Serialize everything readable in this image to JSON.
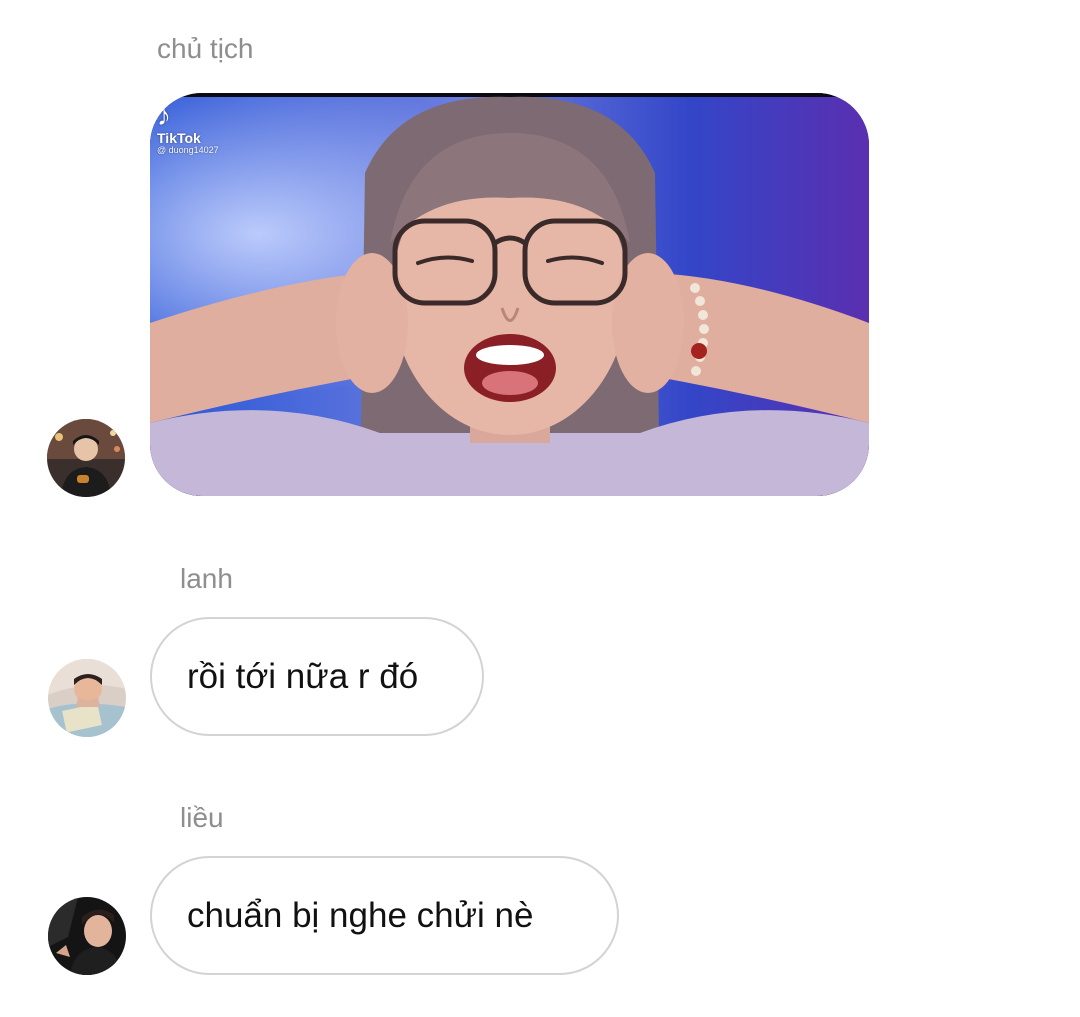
{
  "messages": [
    {
      "sender": "chủ tịch",
      "type": "media",
      "media": {
        "source": "TikTok",
        "logo_glyph": "♪",
        "handle": "@ duong14027",
        "icon": "tiktok-logo-icon"
      }
    },
    {
      "sender": "lanh",
      "type": "text",
      "text": "rồi tới nữa r đó"
    },
    {
      "sender": "liều",
      "type": "text",
      "text": "chuẩn bị nghe chửi nè"
    }
  ],
  "colors": {
    "background": "#ffffff",
    "sender_name": "#8e8e8e",
    "bubble_border": "#d3d3d3",
    "message_text": "#111111"
  }
}
